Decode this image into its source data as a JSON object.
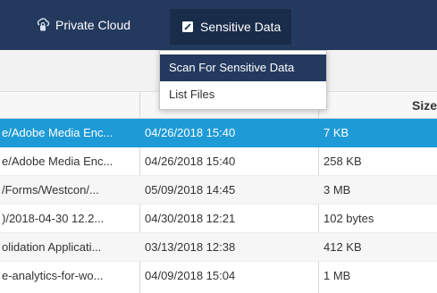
{
  "nav": {
    "items": [
      {
        "label": "Private Cloud",
        "icon": "cloud-lock-icon"
      },
      {
        "label": "Sensitive Data",
        "icon": "document-icon"
      }
    ]
  },
  "dropdown": {
    "items": [
      {
        "label": "Scan For Sensitive Data",
        "active": true
      },
      {
        "label": "List Files",
        "active": false
      }
    ]
  },
  "table": {
    "columns": {
      "size": "Size"
    },
    "rows": [
      {
        "name": "e/Adobe Media Enc...",
        "modified": "04/26/2018 15:40",
        "size": "7 KB"
      },
      {
        "name": "e/Adobe Media Enc...",
        "modified": "04/26/2018 15:40",
        "size": "258 KB"
      },
      {
        "name": "/Forms/Westcon/...",
        "modified": "05/09/2018 14:45",
        "size": "3 MB"
      },
      {
        "name": ")/2018-04-30 12.2...",
        "modified": "04/30/2018 12:21",
        "size": "102 bytes"
      },
      {
        "name": "olidation Applicati...",
        "modified": "03/13/2018 12:38",
        "size": "412 KB"
      },
      {
        "name": "e-analytics-for-wo...",
        "modified": "04/09/2018 15:04",
        "size": "1 MB"
      }
    ],
    "selected_row": 0
  },
  "colors": {
    "nav_bg": "#233a5e",
    "selection": "#1e9ad6",
    "menu_active": "#233a5e"
  }
}
